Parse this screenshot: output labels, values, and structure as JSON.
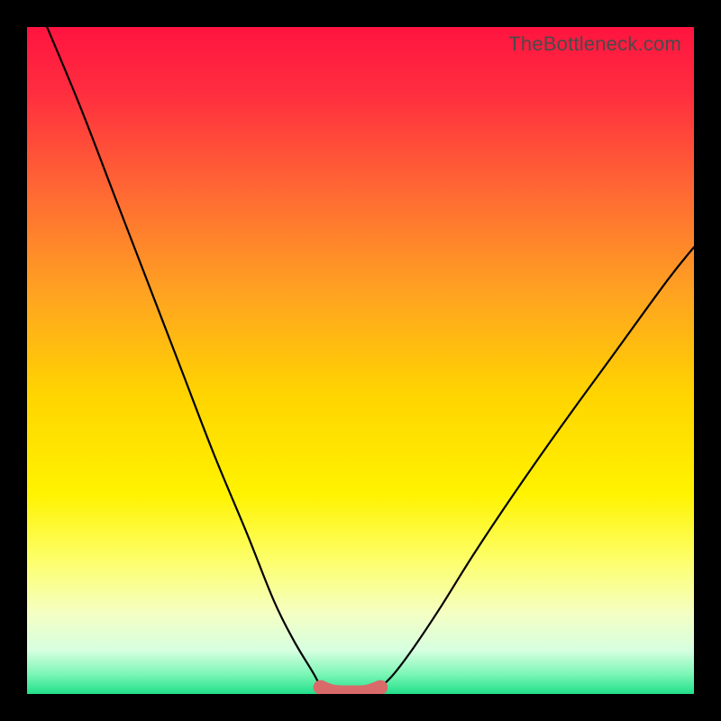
{
  "watermark": "TheBottleneck.com",
  "colors": {
    "frame": "#000000",
    "curve": "#000000",
    "flat_marker": "#d96a6a",
    "grad_stops": [
      {
        "offset": 0.0,
        "color": "#ff1440"
      },
      {
        "offset": 0.1,
        "color": "#ff2e3f"
      },
      {
        "offset": 0.25,
        "color": "#ff6a33"
      },
      {
        "offset": 0.4,
        "color": "#ffa321"
      },
      {
        "offset": 0.55,
        "color": "#ffd400"
      },
      {
        "offset": 0.7,
        "color": "#fff300"
      },
      {
        "offset": 0.8,
        "color": "#fdff6b"
      },
      {
        "offset": 0.88,
        "color": "#f4ffc4"
      },
      {
        "offset": 0.935,
        "color": "#d6ffe0"
      },
      {
        "offset": 0.97,
        "color": "#7cf6b6"
      },
      {
        "offset": 1.0,
        "color": "#21e08a"
      }
    ]
  },
  "chart_data": {
    "type": "line",
    "title": "",
    "xlabel": "",
    "ylabel": "",
    "xlim": [
      0,
      100
    ],
    "ylim": [
      0,
      100
    ],
    "series": [
      {
        "name": "left-curve",
        "x": [
          3,
          8,
          13,
          18,
          23,
          28,
          33,
          37,
          40,
          43,
          44
        ],
        "y": [
          100,
          88,
          75,
          62,
          49,
          36,
          24,
          14,
          8,
          3,
          1
        ]
      },
      {
        "name": "right-curve",
        "x": [
          53,
          55,
          58,
          62,
          67,
          73,
          80,
          88,
          96,
          100
        ],
        "y": [
          1,
          3,
          7,
          13,
          21,
          30,
          40,
          51,
          62,
          67
        ]
      },
      {
        "name": "flat-bottom",
        "x": [
          44,
          46,
          49,
          51,
          53
        ],
        "y": [
          1,
          0.3,
          0.2,
          0.3,
          1
        ]
      }
    ],
    "annotations": []
  }
}
